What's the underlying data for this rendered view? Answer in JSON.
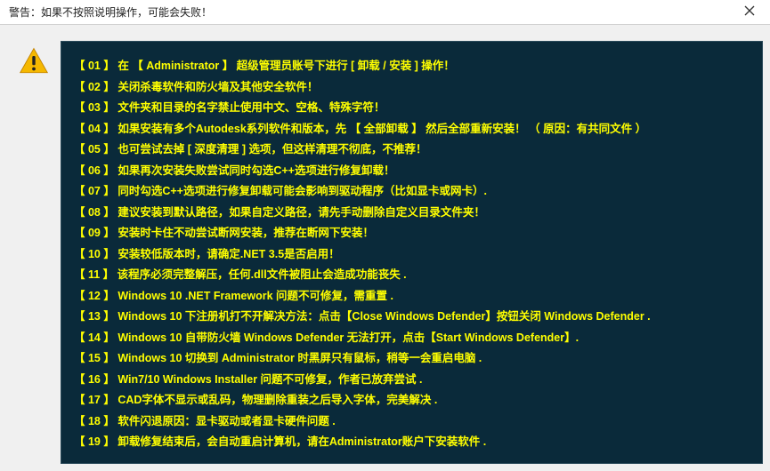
{
  "titlebar": {
    "text": "警告：如果不按照说明操作，可能会失败！"
  },
  "icons": {
    "close": "close-icon",
    "warning": "warning-triangle-icon"
  },
  "messages": [
    {
      "num": "01",
      "text": "在 【 Administrator 】 超级管理员账号下进行 [ 卸载 / 安装 ] 操作！"
    },
    {
      "num": "02",
      "text": "关闭杀毒软件和防火墙及其他安全软件！"
    },
    {
      "num": "03",
      "text": "文件夹和目录的名字禁止使用中文、空格、特殊字符！"
    },
    {
      "num": "04",
      "text": "如果安装有多个Autodesk系列软件和版本，先 【 全部卸载 】 然后全部重新安装！ （ 原因：有共同文件 ）"
    },
    {
      "num": "05",
      "text": "也可尝试去掉 [ 深度清理 ] 选项，但这样清理不彻底，不推荐！"
    },
    {
      "num": "06",
      "text": "如果再次安装失败尝试同时勾选C++选项进行修复卸载！"
    },
    {
      "num": "07",
      "text": "同时勾选C++选项进行修复卸载可能会影响到驱动程序（比如显卡或网卡）."
    },
    {
      "num": "08",
      "text": "建议安装到默认路径，如果自定义路径，请先手动删除自定义目录文件夹！"
    },
    {
      "num": "09",
      "text": "安装时卡住不动尝试断网安装，推荐在断网下安装！"
    },
    {
      "num": "10",
      "text": "安装较低版本时，请确定.NET 3.5是否启用！"
    },
    {
      "num": "11",
      "text": "该程序必须完整解压，任何.dll文件被阻止会造成功能丧失 ."
    },
    {
      "num": "12",
      "text": "Windows 10 .NET Framework 问题不可修复，需重置 ."
    },
    {
      "num": "13",
      "text": "Windows 10 下注册机打不开解决方法：点击【Close Windows Defender】按钮关闭 Windows Defender ."
    },
    {
      "num": "14",
      "text": "Windows 10 自带防火墙 Windows Defender 无法打开，点击【Start Windows Defender】."
    },
    {
      "num": "15",
      "text": "Windows 10 切换到 Administrator 时黑屏只有鼠标，稍等一会重启电脑 ."
    },
    {
      "num": "16",
      "text": "Win7/10 Windows Installer 问题不可修复，作者已放弃尝试 ."
    },
    {
      "num": "17",
      "text": "CAD字体不显示或乱码，物理删除重装之后导入字体，完美解决 ."
    },
    {
      "num": "18",
      "text": "软件闪退原因：显卡驱动或者显卡硬件问题 ."
    },
    {
      "num": "19",
      "text": "卸载修复结束后，会自动重启计算机，请在Administrator账户下安装软件 ."
    }
  ]
}
